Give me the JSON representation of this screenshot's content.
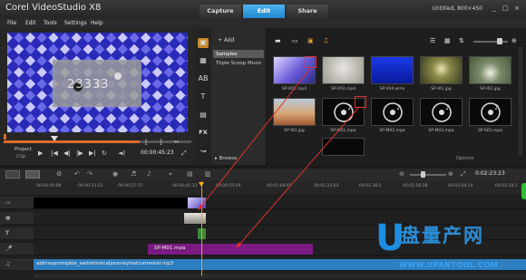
{
  "app": {
    "title": "Corel VideoStudio X8",
    "tabs": [
      "Capture",
      "Edit",
      "Share"
    ],
    "active_tab": "Edit",
    "project_name": "Untitled, 800×450"
  },
  "menu": [
    "File",
    "Edit",
    "Tools",
    "Settings",
    "Help"
  ],
  "preview": {
    "overlay_text": "23333",
    "project_label": "Project",
    "clip_label": "Clip",
    "timecode": "00:00:45:23"
  },
  "library": {
    "add_label": "Add",
    "folders": [
      "Samples",
      "Triple Scoop Music"
    ],
    "browse_label": "Browse",
    "options_label": "Options",
    "thumbs": [
      {
        "name": "SP-V02.mp4"
      },
      {
        "name": "SP-V03.mp4"
      },
      {
        "name": "SP-V04.wmv"
      },
      {
        "name": "SP-I01.jpg"
      },
      {
        "name": "SP-I02.jpg"
      },
      {
        "name": "SP-I03.jpg"
      },
      {
        "name": "SP-M01.mpa"
      },
      {
        "name": "SP-M02.mpa"
      },
      {
        "name": "SP-M03.mpa"
      },
      {
        "name": "SP-S01.mpa"
      }
    ]
  },
  "timeline": {
    "ruler": [
      "00:00:00:00",
      "00:00:13:21",
      "00:00:27:17",
      "00:00:41:13",
      "00:00:55:09",
      "00:01:09:05",
      "00:01:23:03",
      "00:01:36:2",
      "00:01:50:18",
      "00:02:04:14",
      "00:02:18:1"
    ],
    "timecode": "0:02:23:23",
    "music_clip": "SP-M01.mpa",
    "audio_clip": "abbrasprompkie_awholmsicaljourneyinstrumental.mp3"
  },
  "watermark": {
    "logo": "U",
    "cn": "盘量产网",
    "url": "WWW.UPANTOOL.COM"
  },
  "colors": {
    "accent": "#2a8fd8",
    "music_clip": "#7a1a82",
    "audio_track": "#2d7fc0",
    "playhead": "#e0a030",
    "annotation": "#e03030"
  }
}
